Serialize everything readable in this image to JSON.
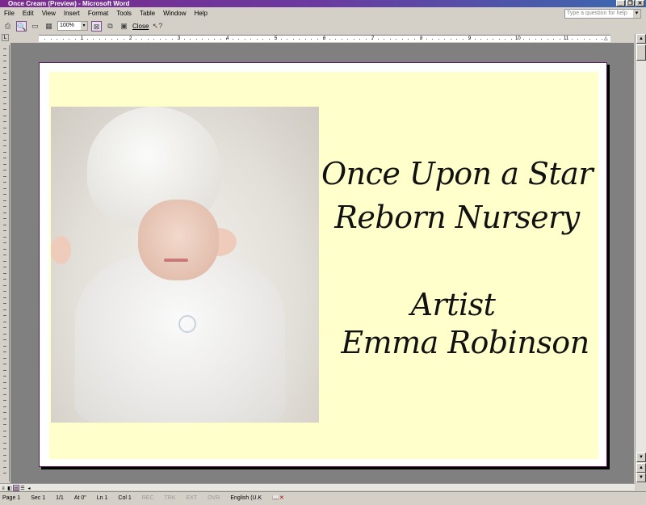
{
  "window": {
    "title": "Once Cream (Preview) - Microsoft Word"
  },
  "menu": [
    "File",
    "Edit",
    "View",
    "Insert",
    "Format",
    "Tools",
    "Table",
    "Window",
    "Help"
  ],
  "help_box": {
    "placeholder": "Type a question for help"
  },
  "toolbar": {
    "zoom": "100%",
    "close": "Close"
  },
  "ruler": [
    "1",
    "2",
    "3",
    "4",
    "5",
    "6",
    "7",
    "8",
    "9",
    "10",
    "11"
  ],
  "document": {
    "line1": "Once Upon a Star",
    "line2": "Reborn Nursery",
    "line3": "Artist",
    "line4": "Emma Robinson",
    "background_color": "#ffffcc"
  },
  "status": {
    "page": "Page 1",
    "sec": "Sec 1",
    "pages": "1/1",
    "at": "At 0\"",
    "ln": "Ln 1",
    "col": "Col 1",
    "rec": "REC",
    "trk": "TRK",
    "ext": "EXT",
    "ovr": "OVR",
    "lang": "English (U.K"
  }
}
